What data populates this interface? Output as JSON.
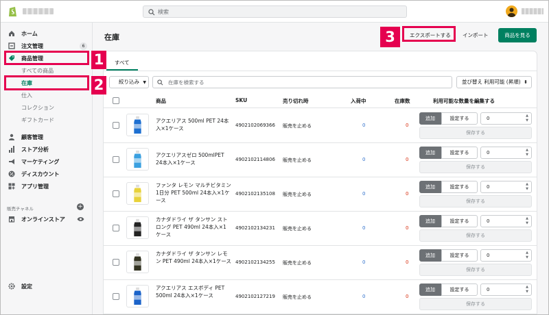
{
  "topbar": {
    "search_placeholder": "検索"
  },
  "sidebar": {
    "items": [
      {
        "label": "ホーム",
        "icon": "home-icon"
      },
      {
        "label": "注文管理",
        "icon": "orders-icon",
        "badge": "6"
      },
      {
        "label": "商品管理",
        "icon": "tag-icon"
      },
      {
        "label": "すべての商品"
      },
      {
        "label": "在庫"
      },
      {
        "label": "仕入"
      },
      {
        "label": "コレクション"
      },
      {
        "label": "ギフトカード"
      },
      {
        "label": "顧客管理",
        "icon": "person-icon"
      },
      {
        "label": "ストア分析",
        "icon": "bar-chart-icon"
      },
      {
        "label": "マーケティング",
        "icon": "megaphone-icon"
      },
      {
        "label": "ディスカウント",
        "icon": "discount-icon"
      },
      {
        "label": "アプリ管理",
        "icon": "apps-icon"
      }
    ],
    "channels_label": "販売チャネル",
    "online_store": "オンラインストア",
    "settings": "設定"
  },
  "page": {
    "title": "在庫",
    "export": "エクスポートする",
    "import": "インポート",
    "view_products": "商品を見る"
  },
  "tabs": {
    "all": "すべて"
  },
  "filters": {
    "filter_label": "絞り込み",
    "search_placeholder": "在庫を検索する",
    "sort_label": "並び替え 利用可能 (昇順)"
  },
  "table": {
    "headers": {
      "product": "商品",
      "sku": "SKU",
      "when_sold_out": "売り切れ時",
      "incoming": "入荷中",
      "stock": "在庫数",
      "edit_available": "利用可能な数量を編集する"
    },
    "add_label": "追加",
    "set_label": "設定する",
    "save_label": "保存する",
    "rows": [
      {
        "name": "アクエリアス 500ml PET 24本入×1ケース",
        "sku": "4902102069366",
        "oos": "販売を止める",
        "incoming": "0",
        "stock": "0",
        "qty": "0",
        "color": "#1d6fd1"
      },
      {
        "name": "アクエリアスゼロ 500mlPET 24本入×1ケース",
        "sku": "4902102114806",
        "oos": "販売を止める",
        "incoming": "0",
        "stock": "0",
        "qty": "0",
        "color": "#3aa0e0"
      },
      {
        "name": "ファンタ レモン マルチビタミン1日分 PET 500ml 24本入×1ケース",
        "sku": "4902102135108",
        "oos": "販売を止める",
        "incoming": "0",
        "stock": "0",
        "qty": "0",
        "color": "#e8d23a"
      },
      {
        "name": "カナダドライ ザ タンサン ストロング PET 490ml 24本入×1ケース",
        "sku": "4902102134231",
        "oos": "販売を止める",
        "incoming": "0",
        "stock": "0",
        "qty": "0",
        "color": "#222222"
      },
      {
        "name": "カナダドライ ザ タンサン レモン PET 490ml 24本入×1ケース",
        "sku": "4902102134255",
        "oos": "販売を止める",
        "incoming": "0",
        "stock": "0",
        "qty": "0",
        "color": "#333322"
      },
      {
        "name": "アクエリアス エスボディ PET 500ml 24本入×1ケース",
        "sku": "4902102127219",
        "oos": "販売を止める",
        "incoming": "0",
        "stock": "0",
        "qty": "0",
        "color": "#1b63c9"
      }
    ]
  },
  "annotations": [
    "1",
    "2",
    "3"
  ],
  "colors": {
    "accent": "#008060",
    "callout": "#e5004f"
  }
}
